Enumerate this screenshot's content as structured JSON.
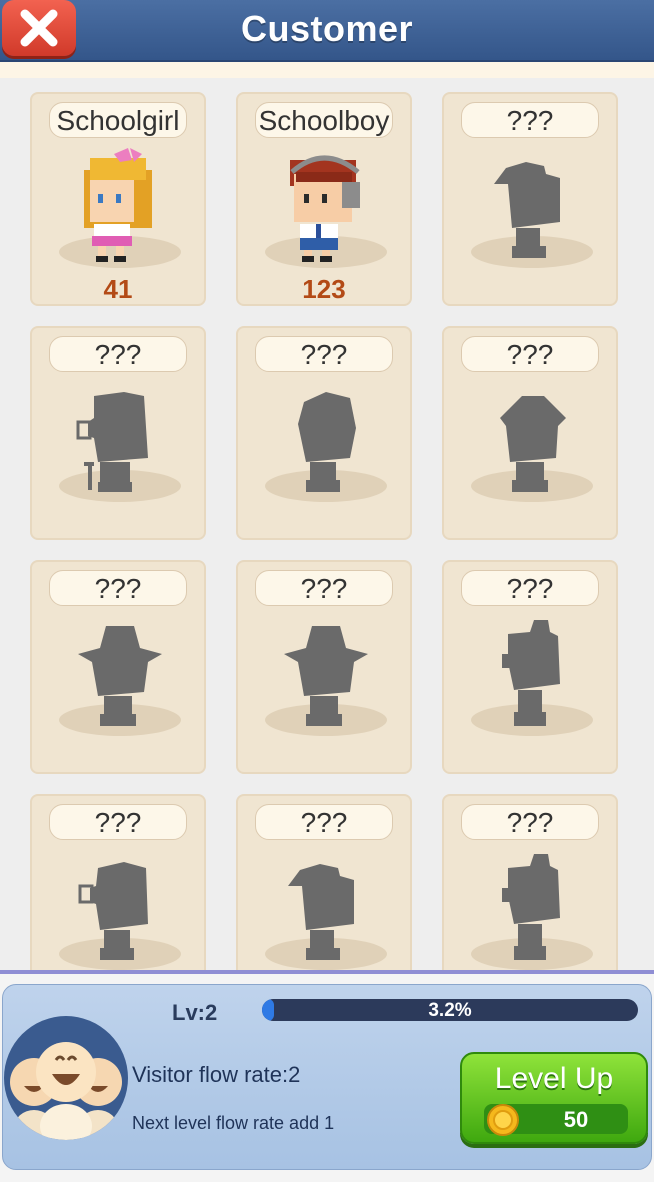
{
  "header": {
    "title": "Customer"
  },
  "customers": [
    {
      "label": "Schoolgirl",
      "count": "41",
      "unlocked": true,
      "kind": "schoolgirl"
    },
    {
      "label": "Schoolboy",
      "count": "123",
      "unlocked": true,
      "kind": "schoolboy"
    },
    {
      "label": "???",
      "unlocked": false,
      "kind": "cap"
    },
    {
      "label": "???",
      "unlocked": false,
      "kind": "glasses-cane"
    },
    {
      "label": "???",
      "unlocked": false,
      "kind": "round"
    },
    {
      "label": "???",
      "unlocked": false,
      "kind": "wide"
    },
    {
      "label": "???",
      "unlocked": false,
      "kind": "hat"
    },
    {
      "label": "???",
      "unlocked": false,
      "kind": "hat"
    },
    {
      "label": "???",
      "unlocked": false,
      "kind": "bun"
    },
    {
      "label": "???",
      "unlocked": false,
      "kind": "glasses"
    },
    {
      "label": "???",
      "unlocked": false,
      "kind": "cap"
    },
    {
      "label": "???",
      "unlocked": false,
      "kind": "bun"
    }
  ],
  "level": {
    "label": "Lv:2",
    "progress_text": "3.2%",
    "progress": 0.032,
    "flow_rate": "Visitor flow rate:2",
    "next_level": "Next level flow rate add  1",
    "button_label": "Level Up",
    "cost": "50"
  },
  "colors": {
    "header": "#3f6398",
    "card": "#f0e5d1",
    "count": "#b34a16",
    "button": "#5cc020",
    "silhouette": "#6a6a6a"
  }
}
